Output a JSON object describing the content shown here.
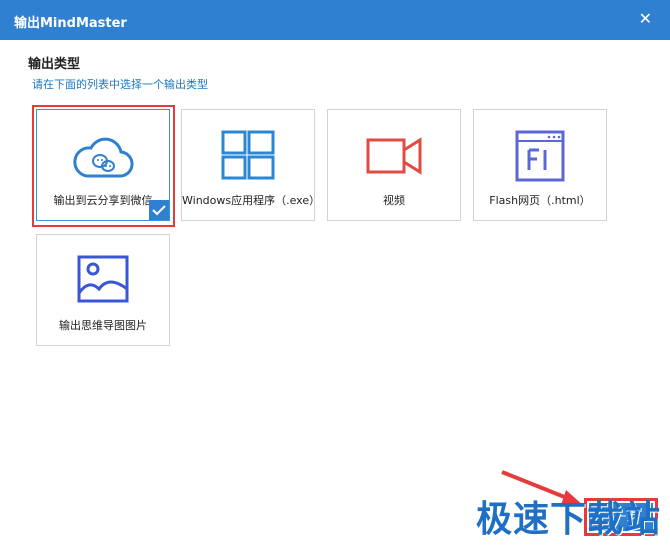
{
  "window": {
    "title": "输出MindMaster",
    "close_glyph": "✕"
  },
  "section": {
    "title": "输出类型",
    "hint": "请在下面的列表中选择一个输出类型"
  },
  "options": [
    {
      "label": "输出到云分享到微信",
      "icon": "cloud-share-icon",
      "selected": true
    },
    {
      "label": "Windows应用程序（.exe）",
      "icon": "windows-logo-icon",
      "selected": false
    },
    {
      "label": "视频",
      "icon": "video-camera-icon",
      "selected": false
    },
    {
      "label": "Flash网页（.html）",
      "icon": "flash-page-icon",
      "selected": false
    },
    {
      "label": "输出思维导图图片",
      "icon": "image-icon",
      "selected": false
    }
  ],
  "next_button": {
    "label": "下一步"
  },
  "watermark": {
    "text": "极速下载站"
  },
  "colors": {
    "accent": "#2f80d1",
    "highlight": "#e53b3b",
    "windows": "#2b87d3",
    "video": "#e24b3f",
    "flash": "#5b67d8",
    "image": "#3a55d8"
  }
}
